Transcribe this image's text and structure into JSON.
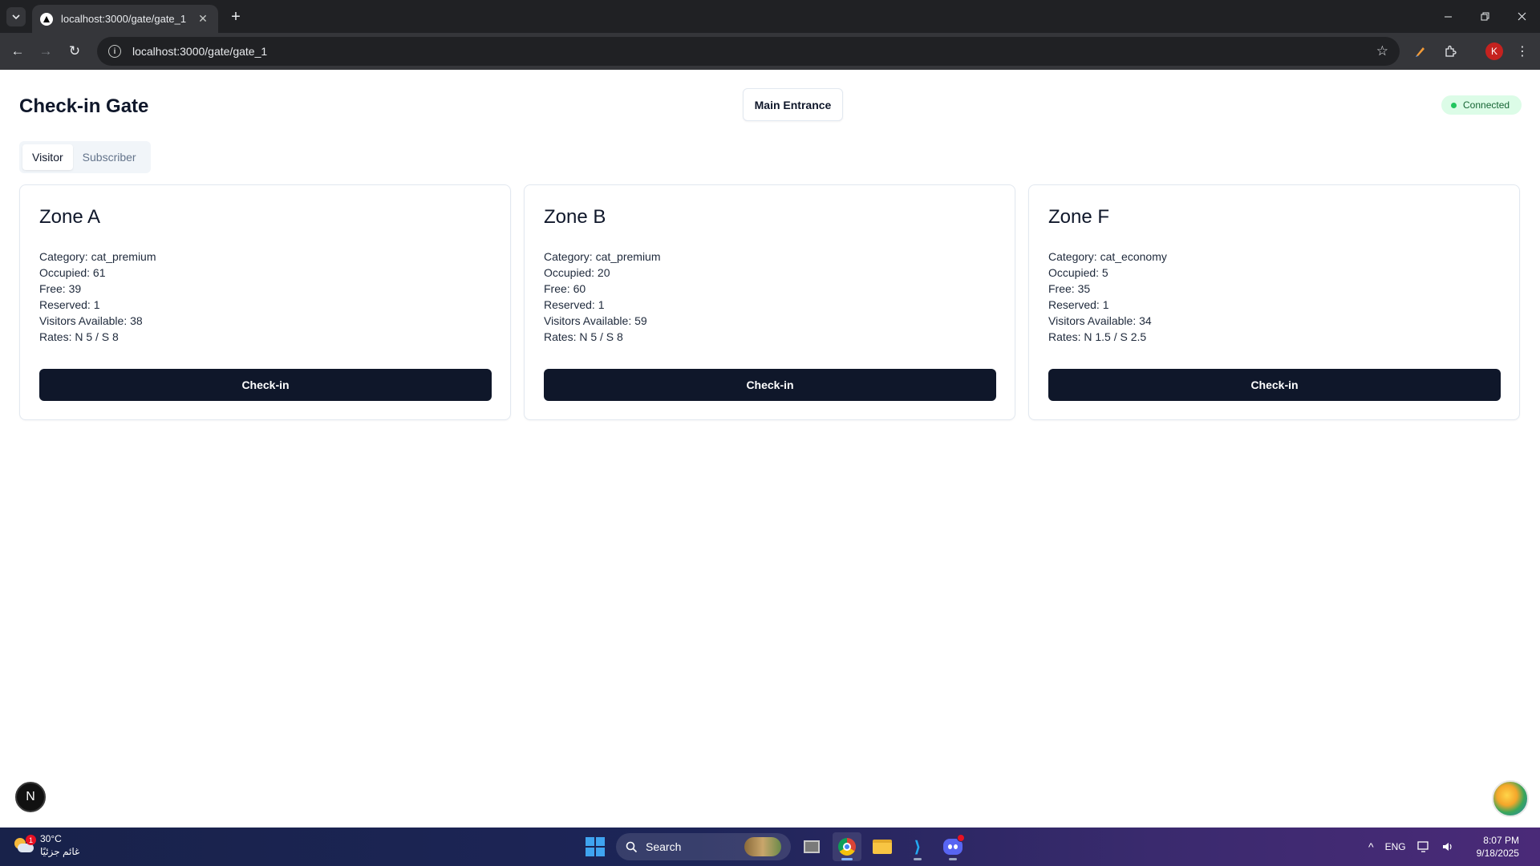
{
  "browser": {
    "tab_title": "localhost:3000/gate/gate_1",
    "url": "localhost:3000/gate/gate_1",
    "profile_initial": "K"
  },
  "page": {
    "title": "Check-in Gate",
    "gate_name": "Main Entrance",
    "status": "Connected",
    "tabs": [
      {
        "label": "Visitor",
        "active": true
      },
      {
        "label": "Subscriber",
        "active": false
      }
    ],
    "zones": [
      {
        "name": "Zone A",
        "category": "Category: cat_premium",
        "occupied": "Occupied: 61",
        "free": "Free: 39",
        "reserved": "Reserved: 1",
        "visitors_available": "Visitors Available: 38",
        "rates": "Rates: N 5 / S 8",
        "button": "Check-in"
      },
      {
        "name": "Zone B",
        "category": "Category: cat_premium",
        "occupied": "Occupied: 20",
        "free": "Free: 60",
        "reserved": "Reserved: 1",
        "visitors_available": "Visitors Available: 59",
        "rates": "Rates: N 5 / S 8",
        "button": "Check-in"
      },
      {
        "name": "Zone F",
        "category": "Category: cat_economy",
        "occupied": "Occupied: 5",
        "free": "Free: 35",
        "reserved": "Reserved: 1",
        "visitors_available": "Visitors Available: 34",
        "rates": "Rates: N 1.5 / S 2.5",
        "button": "Check-in"
      }
    ],
    "dev_badge": "N"
  },
  "taskbar": {
    "weather_temp": "30°C",
    "weather_desc": "غائم جزئيًا",
    "weather_alert": "1",
    "search_label": "Search",
    "language": "ENG",
    "time": "8:07 PM",
    "date": "9/18/2025"
  },
  "colors": {
    "primary_button": "#0f172a",
    "status_bg": "#dcfce7",
    "status_dot": "#22c55e"
  }
}
